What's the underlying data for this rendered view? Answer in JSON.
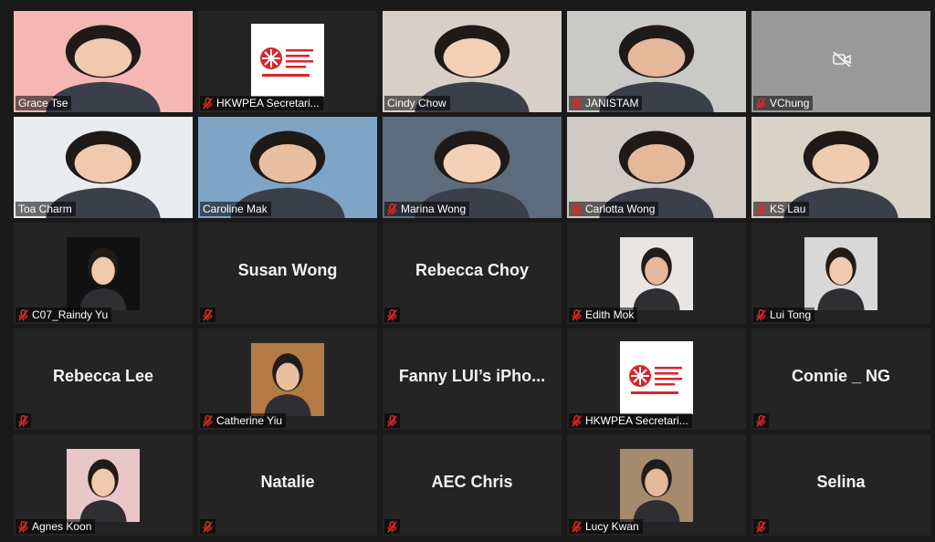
{
  "participants": [
    {
      "name": "Grace Tse",
      "type": "video",
      "muted": false,
      "bg": "#f4b7b4"
    },
    {
      "name": "HKWPEA Secretari...",
      "type": "logo",
      "muted": true
    },
    {
      "name": "Cindy Chow",
      "type": "video",
      "muted": false,
      "bg": "#d8cfc9"
    },
    {
      "name": "JANISTAM",
      "type": "video",
      "muted": true,
      "bg": "#c9c9c6"
    },
    {
      "name": "VChung",
      "type": "video-off",
      "muted": true
    },
    {
      "name": "Toa Charm",
      "type": "video",
      "muted": false,
      "bg": "#e9ecef",
      "active": true
    },
    {
      "name": "Caroline Mak",
      "type": "video",
      "muted": false,
      "bg": "#7ea4c6"
    },
    {
      "name": "Marina Wong",
      "type": "video",
      "muted": true,
      "bg": "#5c6c7c"
    },
    {
      "name": "Carlotta Wong",
      "type": "video",
      "muted": true,
      "bg": "#cfcac6"
    },
    {
      "name": "KS Lau",
      "type": "video",
      "muted": true,
      "bg": "#d9d2c7"
    },
    {
      "name": "C07_Raindy Yu",
      "type": "photo",
      "muted": true,
      "bg": "#111111"
    },
    {
      "name": "Susan Wong",
      "type": "name",
      "muted": true
    },
    {
      "name": "Rebecca Choy",
      "type": "name",
      "muted": true
    },
    {
      "name": "Edith Mok",
      "type": "photo",
      "muted": true,
      "bg": "#e9e5e3"
    },
    {
      "name": "Lui Tong",
      "type": "photo",
      "muted": true,
      "bg": "#d8d8d8"
    },
    {
      "name": "Rebecca Lee",
      "type": "name",
      "muted": true
    },
    {
      "name": "Catherine Yiu",
      "type": "photo",
      "muted": true,
      "bg": "#b37a44"
    },
    {
      "name": "Fanny LUI’s iPho...",
      "type": "name",
      "muted": true
    },
    {
      "name": "HKWPEA Secretari...",
      "type": "logo",
      "muted": true
    },
    {
      "name": "Connie _ NG",
      "type": "name",
      "muted": true
    },
    {
      "name": "Agnes Koon",
      "type": "photo",
      "muted": true,
      "bg": "#e9c7c8"
    },
    {
      "name": "Natalie",
      "type": "name",
      "muted": true
    },
    {
      "name": "AEC Chris",
      "type": "name",
      "muted": true
    },
    {
      "name": "Lucy Kwan",
      "type": "photo",
      "muted": true,
      "bg": "#a58a6e"
    },
    {
      "name": "Selina",
      "type": "name",
      "muted": true
    }
  ],
  "colors": {
    "accent": "#c6d94b",
    "muted_icon": "#e02828",
    "logo_red": "#d7262c",
    "tile_bg": "#242424"
  },
  "icons": {
    "muted": "mic-muted-icon",
    "video_off": "video-off-icon"
  }
}
